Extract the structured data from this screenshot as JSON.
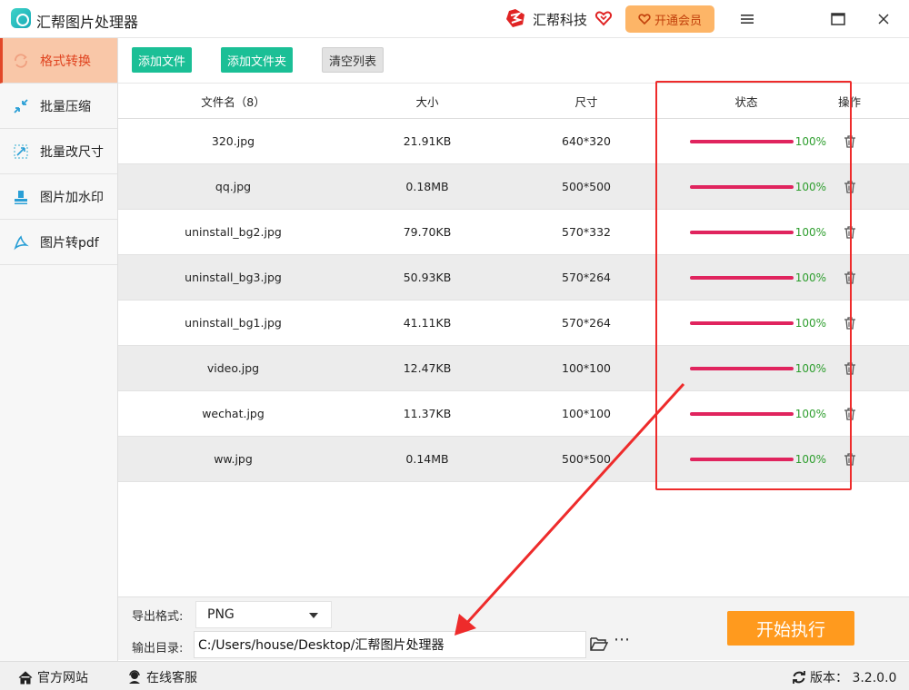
{
  "app": {
    "title": "汇帮图片处理器",
    "brand_name": "汇帮科技",
    "vip_label": "开通会员"
  },
  "sidebar": {
    "items": [
      {
        "label": "格式转换",
        "icon": "convert-icon",
        "active": true
      },
      {
        "label": "批量压缩",
        "icon": "compress-icon",
        "active": false
      },
      {
        "label": "批量改尺寸",
        "icon": "resize-icon",
        "active": false
      },
      {
        "label": "图片加水印",
        "icon": "watermark-icon",
        "active": false
      },
      {
        "label": "图片转pdf",
        "icon": "pdf-icon",
        "active": false
      }
    ]
  },
  "toolbar": {
    "add_file": "添加文件",
    "add_folder": "添加文件夹",
    "clear_list": "清空列表"
  },
  "table": {
    "headers": {
      "name": "文件名（8）",
      "size": "大小",
      "dimension": "尺寸",
      "status": "状态",
      "action": "操作"
    },
    "rows": [
      {
        "name": "320.jpg",
        "size": "21.91KB",
        "dimension": "640*320",
        "progress": "100%"
      },
      {
        "name": "qq.jpg",
        "size": "0.18MB",
        "dimension": "500*500",
        "progress": "100%"
      },
      {
        "name": "uninstall_bg2.jpg",
        "size": "79.70KB",
        "dimension": "570*332",
        "progress": "100%"
      },
      {
        "name": "uninstall_bg3.jpg",
        "size": "50.93KB",
        "dimension": "570*264",
        "progress": "100%"
      },
      {
        "name": "uninstall_bg1.jpg",
        "size": "41.11KB",
        "dimension": "570*264",
        "progress": "100%"
      },
      {
        "name": "video.jpg",
        "size": "12.47KB",
        "dimension": "100*100",
        "progress": "100%"
      },
      {
        "name": "wechat.jpg",
        "size": "11.37KB",
        "dimension": "100*100",
        "progress": "100%"
      },
      {
        "name": "ww.jpg",
        "size": "0.14MB",
        "dimension": "500*500",
        "progress": "100%"
      }
    ]
  },
  "bottom": {
    "format_label": "导出格式:",
    "format_value": "PNG",
    "output_label": "输出目录:",
    "output_path": "C:/Users/house/Desktop/汇帮图片处理器",
    "start_label": "开始执行"
  },
  "statusbar": {
    "website": "官方网站",
    "support": "在线客服",
    "version": "版本： 3.2.0.0"
  },
  "colors": {
    "accent_green": "#1bbf96",
    "progress_bar": "#e0245e",
    "progress_text": "#2e9e2e",
    "start_button": "#ff9a1e",
    "highlight_red": "#ee2b2b",
    "active_nav_bg": "#f9c7a8"
  }
}
